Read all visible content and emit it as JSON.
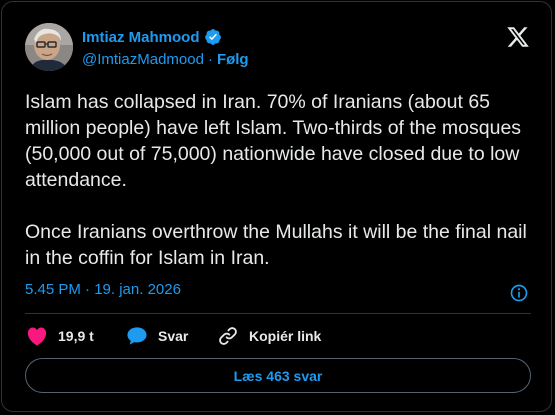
{
  "author": {
    "name": "Imtiaz Mahmood",
    "handle": "@ImtiazMadmood",
    "separator": "·",
    "follow_label": "Følg",
    "avatar": "profile-photo",
    "verified_icon": "verified-badge-icon"
  },
  "platform_icon": "x-logo-icon",
  "tweet": {
    "paragraph_1": "Islam has collapsed in Iran. 70% of Iranians (about 65 million people) have left Islam. Two-thirds of the mosques (50,000 out of 75,000) nationwide have closed due to low attendance.",
    "paragraph_2": "Once Iranians overthrow the Mullahs it will be the final nail in the coffin for Islam in Iran."
  },
  "timestamp": "5.45 PM · 19. jan. 2026",
  "info_icon": "info-icon",
  "actions": {
    "likes_count": "19,9 t",
    "reply_label": "Svar",
    "copy_link_label": "Kopiér link"
  },
  "read_replies_label": "Læs 463 svar",
  "colors": {
    "background": "#000000",
    "accent": "#1d9bf0",
    "text": "#e7e9ea",
    "like": "#f91880",
    "border": "#2f3336"
  }
}
